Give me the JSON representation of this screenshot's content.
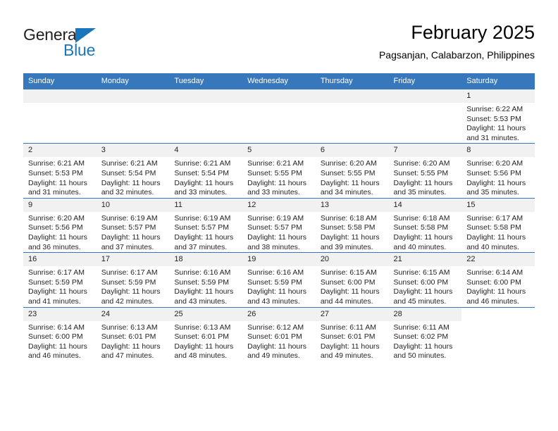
{
  "brand": {
    "name_top": "General",
    "name_bottom": "Blue",
    "triangle_color": "#1b75bb"
  },
  "header": {
    "month_title": "February 2025",
    "location": "Pagsanjan, Calabarzon, Philippines"
  },
  "theme": {
    "header_bg": "#3777bc",
    "header_text": "#ffffff",
    "daynum_bg": "#f1f1f1",
    "body_text": "#231f20"
  },
  "calendar": {
    "weekday_headers": [
      "Sunday",
      "Monday",
      "Tuesday",
      "Wednesday",
      "Thursday",
      "Friday",
      "Saturday"
    ],
    "weeks": [
      [
        {
          "day": "",
          "empty": true,
          "strip": true,
          "lines": []
        },
        {
          "day": "",
          "empty": true,
          "strip": true,
          "lines": []
        },
        {
          "day": "",
          "empty": true,
          "strip": true,
          "lines": []
        },
        {
          "day": "",
          "empty": true,
          "strip": true,
          "lines": []
        },
        {
          "day": "",
          "empty": true,
          "strip": true,
          "lines": []
        },
        {
          "day": "",
          "empty": true,
          "strip": true,
          "lines": []
        },
        {
          "day": "1",
          "empty": false,
          "strip": true,
          "lines": [
            "Sunrise: 6:22 AM",
            "Sunset: 5:53 PM",
            "Daylight: 11 hours",
            "and 31 minutes."
          ]
        }
      ],
      [
        {
          "day": "2",
          "empty": false,
          "strip": true,
          "lines": [
            "Sunrise: 6:21 AM",
            "Sunset: 5:53 PM",
            "Daylight: 11 hours",
            "and 31 minutes."
          ]
        },
        {
          "day": "3",
          "empty": false,
          "strip": true,
          "lines": [
            "Sunrise: 6:21 AM",
            "Sunset: 5:54 PM",
            "Daylight: 11 hours",
            "and 32 minutes."
          ]
        },
        {
          "day": "4",
          "empty": false,
          "strip": true,
          "lines": [
            "Sunrise: 6:21 AM",
            "Sunset: 5:54 PM",
            "Daylight: 11 hours",
            "and 33 minutes."
          ]
        },
        {
          "day": "5",
          "empty": false,
          "strip": true,
          "lines": [
            "Sunrise: 6:21 AM",
            "Sunset: 5:55 PM",
            "Daylight: 11 hours",
            "and 33 minutes."
          ]
        },
        {
          "day": "6",
          "empty": false,
          "strip": true,
          "lines": [
            "Sunrise: 6:20 AM",
            "Sunset: 5:55 PM",
            "Daylight: 11 hours",
            "and 34 minutes."
          ]
        },
        {
          "day": "7",
          "empty": false,
          "strip": true,
          "lines": [
            "Sunrise: 6:20 AM",
            "Sunset: 5:55 PM",
            "Daylight: 11 hours",
            "and 35 minutes."
          ]
        },
        {
          "day": "8",
          "empty": false,
          "strip": true,
          "lines": [
            "Sunrise: 6:20 AM",
            "Sunset: 5:56 PM",
            "Daylight: 11 hours",
            "and 35 minutes."
          ]
        }
      ],
      [
        {
          "day": "9",
          "empty": false,
          "strip": true,
          "lines": [
            "Sunrise: 6:20 AM",
            "Sunset: 5:56 PM",
            "Daylight: 11 hours",
            "and 36 minutes."
          ]
        },
        {
          "day": "10",
          "empty": false,
          "strip": true,
          "lines": [
            "Sunrise: 6:19 AM",
            "Sunset: 5:57 PM",
            "Daylight: 11 hours",
            "and 37 minutes."
          ]
        },
        {
          "day": "11",
          "empty": false,
          "strip": true,
          "lines": [
            "Sunrise: 6:19 AM",
            "Sunset: 5:57 PM",
            "Daylight: 11 hours",
            "and 37 minutes."
          ]
        },
        {
          "day": "12",
          "empty": false,
          "strip": true,
          "lines": [
            "Sunrise: 6:19 AM",
            "Sunset: 5:57 PM",
            "Daylight: 11 hours",
            "and 38 minutes."
          ]
        },
        {
          "day": "13",
          "empty": false,
          "strip": true,
          "lines": [
            "Sunrise: 6:18 AM",
            "Sunset: 5:58 PM",
            "Daylight: 11 hours",
            "and 39 minutes."
          ]
        },
        {
          "day": "14",
          "empty": false,
          "strip": true,
          "lines": [
            "Sunrise: 6:18 AM",
            "Sunset: 5:58 PM",
            "Daylight: 11 hours",
            "and 40 minutes."
          ]
        },
        {
          "day": "15",
          "empty": false,
          "strip": true,
          "lines": [
            "Sunrise: 6:17 AM",
            "Sunset: 5:58 PM",
            "Daylight: 11 hours",
            "and 40 minutes."
          ]
        }
      ],
      [
        {
          "day": "16",
          "empty": false,
          "strip": true,
          "lines": [
            "Sunrise: 6:17 AM",
            "Sunset: 5:59 PM",
            "Daylight: 11 hours",
            "and 41 minutes."
          ]
        },
        {
          "day": "17",
          "empty": false,
          "strip": true,
          "lines": [
            "Sunrise: 6:17 AM",
            "Sunset: 5:59 PM",
            "Daylight: 11 hours",
            "and 42 minutes."
          ]
        },
        {
          "day": "18",
          "empty": false,
          "strip": true,
          "lines": [
            "Sunrise: 6:16 AM",
            "Sunset: 5:59 PM",
            "Daylight: 11 hours",
            "and 43 minutes."
          ]
        },
        {
          "day": "19",
          "empty": false,
          "strip": true,
          "lines": [
            "Sunrise: 6:16 AM",
            "Sunset: 5:59 PM",
            "Daylight: 11 hours",
            "and 43 minutes."
          ]
        },
        {
          "day": "20",
          "empty": false,
          "strip": true,
          "lines": [
            "Sunrise: 6:15 AM",
            "Sunset: 6:00 PM",
            "Daylight: 11 hours",
            "and 44 minutes."
          ]
        },
        {
          "day": "21",
          "empty": false,
          "strip": true,
          "lines": [
            "Sunrise: 6:15 AM",
            "Sunset: 6:00 PM",
            "Daylight: 11 hours",
            "and 45 minutes."
          ]
        },
        {
          "day": "22",
          "empty": false,
          "strip": true,
          "lines": [
            "Sunrise: 6:14 AM",
            "Sunset: 6:00 PM",
            "Daylight: 11 hours",
            "and 46 minutes."
          ]
        }
      ],
      [
        {
          "day": "23",
          "empty": false,
          "strip": true,
          "lines": [
            "Sunrise: 6:14 AM",
            "Sunset: 6:00 PM",
            "Daylight: 11 hours",
            "and 46 minutes."
          ]
        },
        {
          "day": "24",
          "empty": false,
          "strip": true,
          "lines": [
            "Sunrise: 6:13 AM",
            "Sunset: 6:01 PM",
            "Daylight: 11 hours",
            "and 47 minutes."
          ]
        },
        {
          "day": "25",
          "empty": false,
          "strip": true,
          "lines": [
            "Sunrise: 6:13 AM",
            "Sunset: 6:01 PM",
            "Daylight: 11 hours",
            "and 48 minutes."
          ]
        },
        {
          "day": "26",
          "empty": false,
          "strip": true,
          "lines": [
            "Sunrise: 6:12 AM",
            "Sunset: 6:01 PM",
            "Daylight: 11 hours",
            "and 49 minutes."
          ]
        },
        {
          "day": "27",
          "empty": false,
          "strip": true,
          "lines": [
            "Sunrise: 6:11 AM",
            "Sunset: 6:01 PM",
            "Daylight: 11 hours",
            "and 49 minutes."
          ]
        },
        {
          "day": "28",
          "empty": false,
          "strip": true,
          "lines": [
            "Sunrise: 6:11 AM",
            "Sunset: 6:02 PM",
            "Daylight: 11 hours",
            "and 50 minutes."
          ]
        },
        {
          "day": "",
          "empty": true,
          "strip": false,
          "lines": []
        }
      ]
    ]
  }
}
